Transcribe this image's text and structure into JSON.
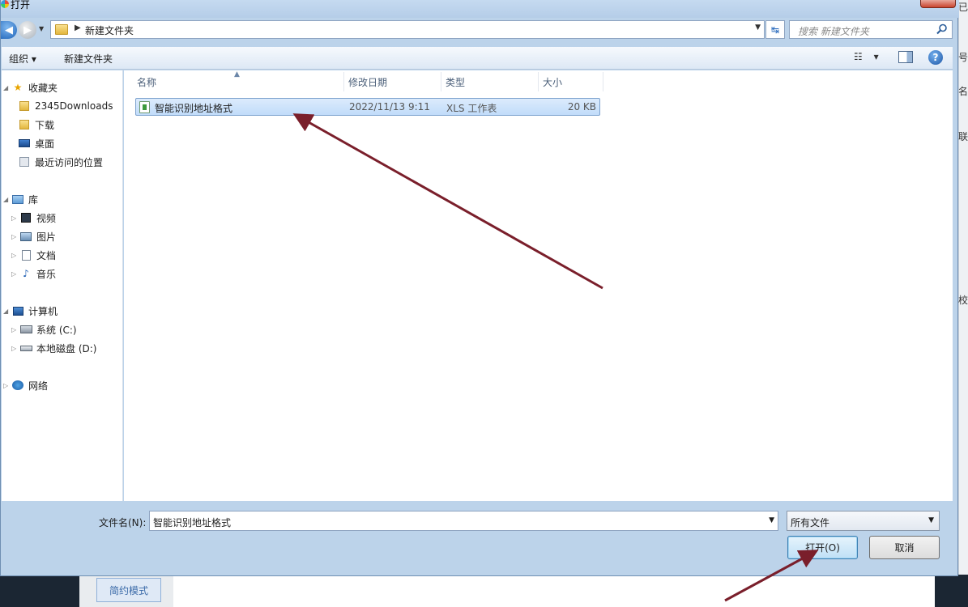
{
  "window": {
    "title": "打开"
  },
  "address": {
    "current_folder": "新建文件夹",
    "search_placeholder": "搜索 新建文件夹"
  },
  "toolbar": {
    "organize_label": "组织 ▾",
    "new_folder_label": "新建文件夹",
    "view_icon": "view-list-icon",
    "view_dropdown": "▾"
  },
  "nav": {
    "favorites": {
      "label": "收藏夹",
      "items": [
        "2345Downloads",
        "下载",
        "桌面",
        "最近访问的位置"
      ]
    },
    "libraries": {
      "label": "库",
      "items": [
        "视频",
        "图片",
        "文档",
        "音乐"
      ]
    },
    "computer": {
      "label": "计算机",
      "items": [
        "系统 (C:)",
        "本地磁盘 (D:)"
      ]
    },
    "network": {
      "label": "网络"
    }
  },
  "columns": [
    "名称",
    "修改日期",
    "类型",
    "大小"
  ],
  "files": [
    {
      "name": "智能识别地址格式",
      "modified": "2022/11/13 9:11",
      "type": "XLS 工作表",
      "size": "20 KB",
      "selected": true
    }
  ],
  "bottom": {
    "filename_label": "文件名(N):",
    "filename_value": "智能识别地址格式",
    "filetype_value": "所有文件",
    "open_label": "打开(O)",
    "cancel_label": "取消"
  },
  "background": {
    "simple_mode_label": "简约模式",
    "right_edge_glyphs": [
      "已",
      "号",
      "名",
      "联",
      "校"
    ]
  },
  "colors": {
    "selection": "#c1dcfa",
    "arrow": "#7a1f2b",
    "help_blue": "#1d57a6"
  }
}
